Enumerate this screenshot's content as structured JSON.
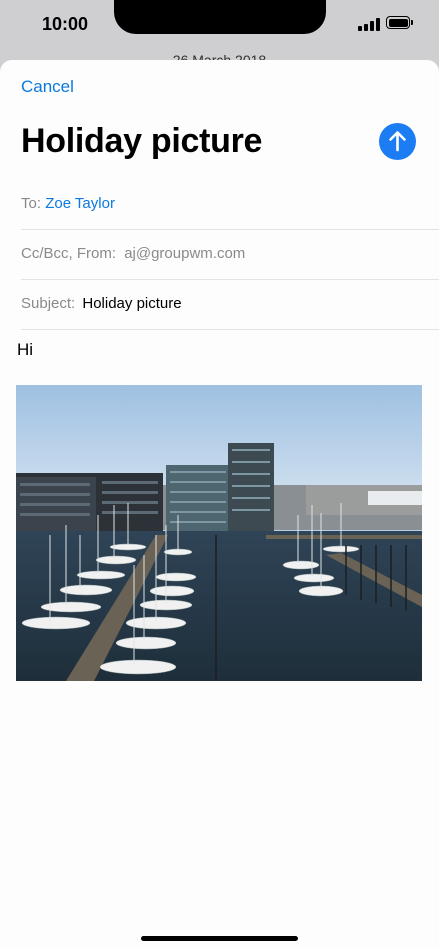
{
  "status_bar": {
    "time": "10:00",
    "icons": [
      "signal-icon",
      "battery-icon"
    ]
  },
  "background": {
    "date_text": "26 March 2018"
  },
  "compose": {
    "cancel_label": "Cancel",
    "title": "Holiday picture",
    "send_icon": "arrow-up-icon",
    "accent_color": "#1c7cf3",
    "to": {
      "label": "To:",
      "value": "Zoe Taylor"
    },
    "ccbcc": {
      "label": "Cc/Bcc, From:",
      "value": "aj@groupwm.com"
    },
    "subject": {
      "label": "Subject:",
      "value": "Holiday picture"
    },
    "body_text": "Hi",
    "attachment": "photo-attachment"
  }
}
